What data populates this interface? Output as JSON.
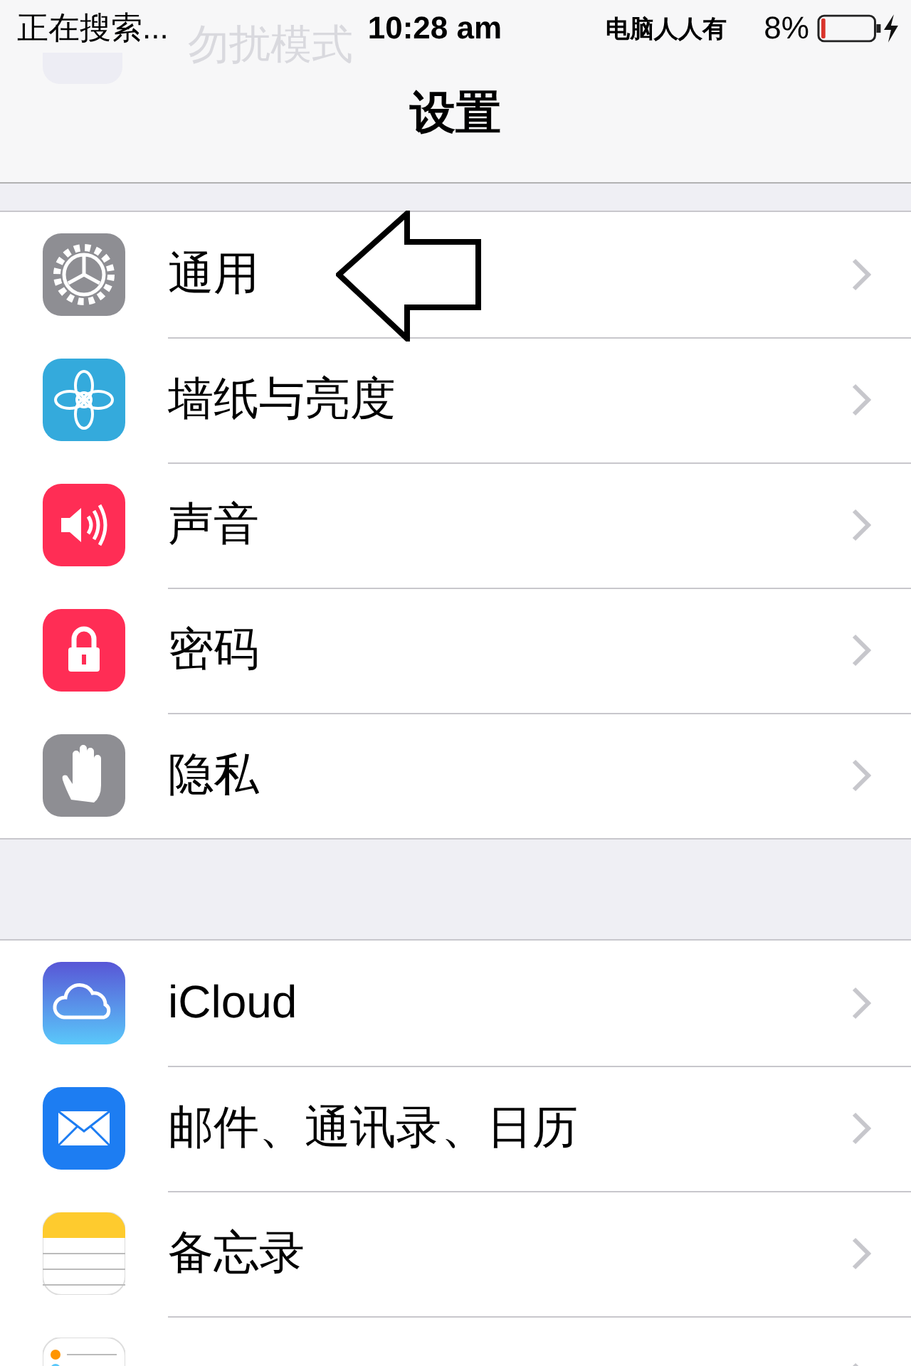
{
  "status_bar": {
    "activity": "正在搜索...",
    "time": "10:28 am",
    "carrier": "电脑人人有",
    "battery": "8%",
    "level": 0.08,
    "charging": true
  },
  "ghost_banner": {
    "text": "勿扰模式"
  },
  "nav": {
    "title": "设置"
  },
  "groups": [
    {
      "items": [
        {
          "label": "通用",
          "kind": "gear"
        },
        {
          "label": "墙纸与亮度",
          "kind": "flower"
        },
        {
          "label": "声音",
          "kind": "speaker"
        },
        {
          "label": "密码",
          "kind": "lock"
        },
        {
          "label": "隐私",
          "kind": "hand"
        }
      ]
    },
    {
      "items": [
        {
          "label": "iCloud",
          "kind": "cloud"
        },
        {
          "label": "邮件、通讯录、日历",
          "kind": "mail"
        },
        {
          "label": "备忘录",
          "kind": "notes"
        },
        {
          "kind": "reminders"
        }
      ]
    }
  ]
}
